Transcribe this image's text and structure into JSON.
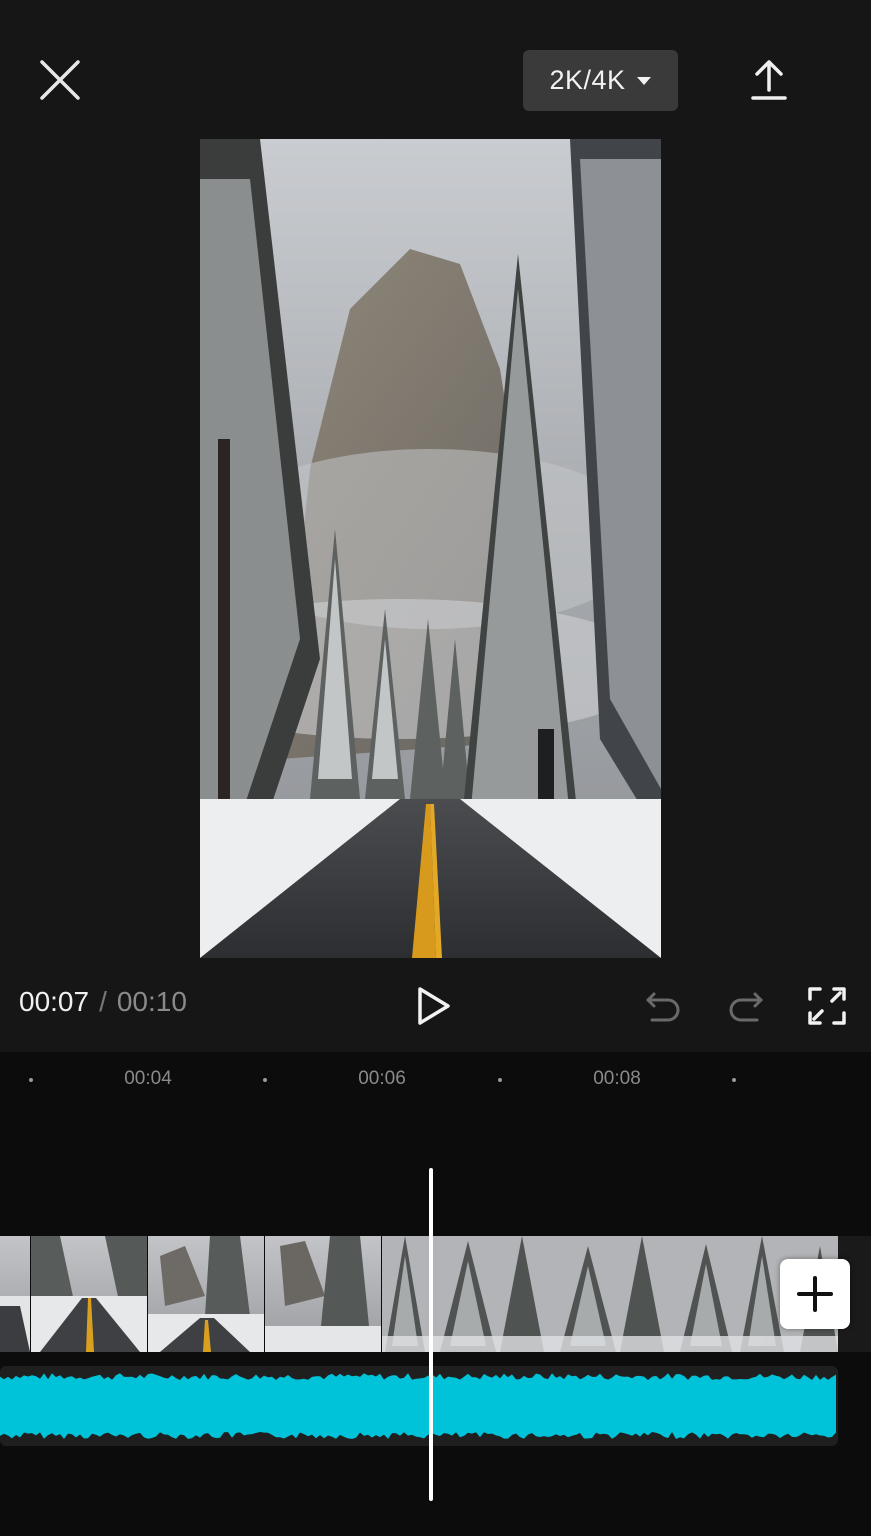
{
  "top_bar": {
    "close_icon": "close-icon",
    "resolution_label": "2K/4K",
    "export_icon": "upload-icon"
  },
  "preview": {
    "description_icon": "video-frame"
  },
  "playback": {
    "current_time": "00:07",
    "separator": "/",
    "total_time": "00:10",
    "play_icon": "play-icon",
    "undo_icon": "undo-icon",
    "redo_icon": "redo-icon",
    "fullscreen_icon": "fullscreen-icon"
  },
  "timeline": {
    "ruler_labels": [
      "00:04",
      "00:06",
      "00:08"
    ],
    "playhead_time": "00:07",
    "audio_color": "#00c2d8",
    "add_icon": "plus-icon"
  },
  "colors": {
    "background": "#161616",
    "timeline_bg": "#0c0c0c",
    "audio_wave": "#00c2d8"
  }
}
